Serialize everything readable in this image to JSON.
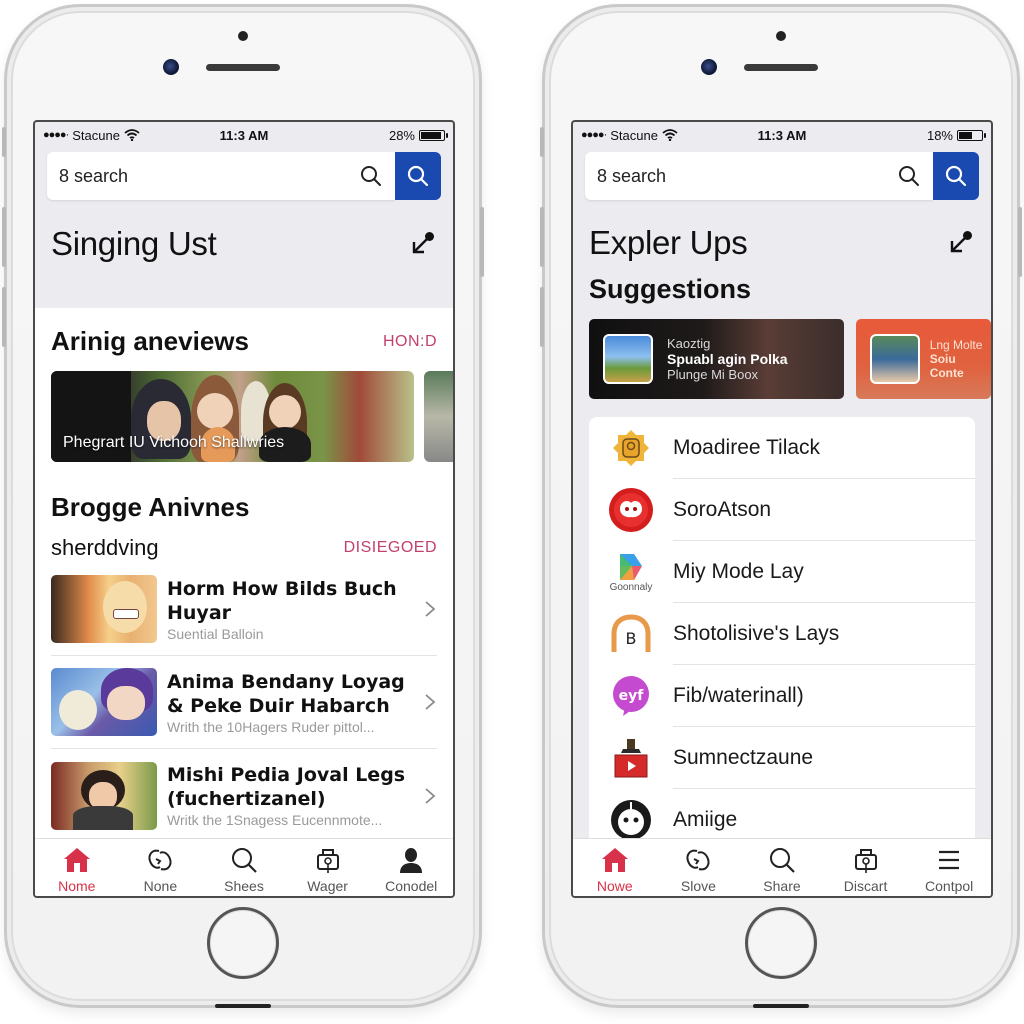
{
  "left_phone": {
    "status": {
      "carrier": "Stacune",
      "time": "11:3 AM",
      "battery": "28%",
      "battery_level_percent": 28
    },
    "search": {
      "value": "8 search"
    },
    "title": "Singing Ust",
    "featured": {
      "title": "Arinig aneviews",
      "link": "HON:D",
      "hero_caption": "Phegrart IU Vichooh Shallwries"
    },
    "section2": {
      "title": "Brogge Anivnes",
      "subtitle": "sherddving",
      "link": "DISIEGOED"
    },
    "items": [
      {
        "title": "Horm How Bilds Buch Huyar",
        "subtitle": "Suential Balloin"
      },
      {
        "title": "Anima Bendany Loyag & Peke Duir Habarch",
        "subtitle": "Writh the 10Hagers Ruder pittol..."
      },
      {
        "title": "Mishi Pedia Joval Legs (fuchertizanel)",
        "subtitle": "Writk the 1Snagess Eucennmote..."
      }
    ],
    "tabs": [
      {
        "label": "Nome",
        "icon": "home-icon",
        "active": true
      },
      {
        "label": "None",
        "icon": "loop-icon",
        "active": false
      },
      {
        "label": "Shees",
        "icon": "search-icon",
        "active": false
      },
      {
        "label": "Wager",
        "icon": "bag-icon",
        "active": false
      },
      {
        "label": "Conodel",
        "icon": "person-icon",
        "active": false
      }
    ]
  },
  "right_phone": {
    "status": {
      "carrier": "Stacune",
      "time": "11:3 AM",
      "battery": "18%",
      "battery_level_percent": 18
    },
    "search": {
      "value": "8 search"
    },
    "title": "Expler Ups",
    "suggestions": {
      "title": "Suggestions",
      "cards": [
        {
          "kicker": "Kaoztig",
          "title": "Spuabl agin Polka",
          "subtitle": "Plunge Mi Boox"
        },
        {
          "kicker": "Lng Molte",
          "title": "Soiu Conte"
        }
      ]
    },
    "apps": [
      {
        "name": "Moadiree Tilack",
        "icon": "badge-icon"
      },
      {
        "name": "SoroAtson",
        "icon": "red-circle-app-icon"
      },
      {
        "name": "Miy Mode Lay",
        "icon": "play-store-icon",
        "icon_caption": "Goonnaly"
      },
      {
        "name": "Shotolisive's Lays",
        "icon": "arch-icon"
      },
      {
        "name": "Fib/waterinall)",
        "icon": "chat-bubble-icon",
        "icon_text": "eyf"
      },
      {
        "name": "Sumnectzaune",
        "icon": "video-box-icon"
      },
      {
        "name": "Amiige",
        "icon": "face-icon"
      }
    ],
    "tabs": [
      {
        "label": "Nowe",
        "icon": "home-icon",
        "active": true
      },
      {
        "label": "Slove",
        "icon": "loop-icon",
        "active": false
      },
      {
        "label": "Share",
        "icon": "search-icon",
        "active": false
      },
      {
        "label": "Discart",
        "icon": "bag-icon",
        "active": false
      },
      {
        "label": "Contpol",
        "icon": "menu-icon",
        "active": false
      }
    ]
  },
  "colors": {
    "accent_red": "#d8324a",
    "link_pink": "#c2406e",
    "search_blue": "#1a4ab0"
  }
}
